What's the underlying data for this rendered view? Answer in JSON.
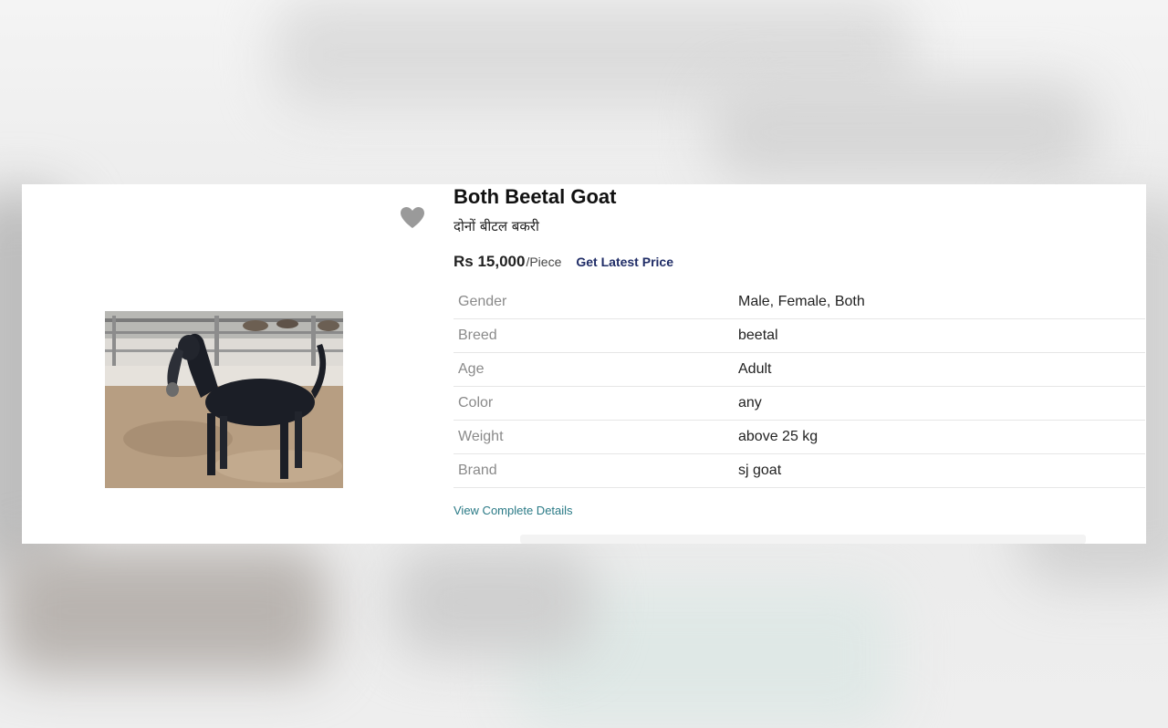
{
  "product": {
    "title": "Both Beetal Goat",
    "subtitle": "दोनों बीटल बकरी",
    "price": "Rs 15,000",
    "unit": "/Piece",
    "get_latest_price": "Get Latest Price",
    "view_details": "View Complete Details",
    "favorite_icon": "heart-icon",
    "image": "black goat standing in a pen",
    "specs": [
      {
        "key": "Gender",
        "value": "Male, Female, Both"
      },
      {
        "key": "Breed",
        "value": "beetal"
      },
      {
        "key": "Age",
        "value": "Adult"
      },
      {
        "key": "Color",
        "value": "any"
      },
      {
        "key": "Weight",
        "value": "above 25 kg"
      },
      {
        "key": "Brand",
        "value": "sj goat"
      }
    ]
  },
  "colors": {
    "price_link": "#1f2c66",
    "details_link": "#2a7a86",
    "heart": "#9a9a9a"
  }
}
